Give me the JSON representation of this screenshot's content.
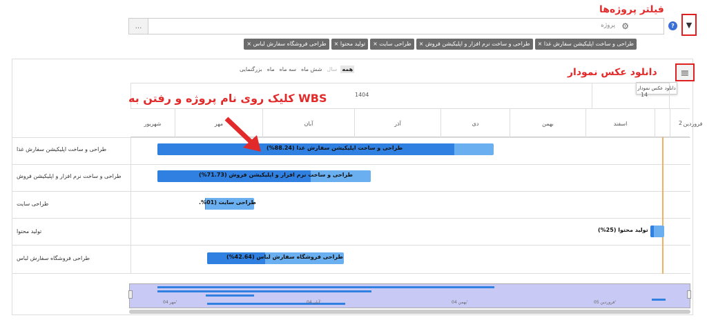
{
  "toolbar": {
    "search_placeholder": "پروژه",
    "more_label": "...",
    "help_label": "?",
    "filter_icon": "filter-icon"
  },
  "annotations": {
    "filter_label": "فیلتر پروژه‌ها",
    "download_label": "دانلود عکس نمودار",
    "click_hint": "کلیک روی نام پروژه و رفتن به WBS"
  },
  "chips": [
    "طراحی و ساخت اپلیکیشن سفارش غذا ×",
    "طراحی و ساخت نرم افزار و اپلیکیشن فروش ×",
    "طراحی سایت ×",
    "تولید محتوا ×",
    "طراحی فروشگاه سفارش لباس ×"
  ],
  "zoom": {
    "options": [
      "همه",
      "سال",
      "شش ماه",
      "سه ماه",
      "ماه",
      "بزرگنمایی"
    ],
    "active": "همه"
  },
  "download_tooltip": "دانلود عکس نمودار",
  "timeline": {
    "year": "1404",
    "next_year_fragment": "14",
    "edge_label": "2",
    "months": [
      "شهریور",
      "مهر",
      "آبان",
      "آذر",
      "دی",
      "بهمن",
      "اسفند",
      "فروردین"
    ]
  },
  "rows": [
    {
      "name": "طراحی و ساخت اپلیکیشن سفارش غذا",
      "bar_label": "طراحی و ساخت اپلیکیشن سفارش غذا (88.24%)",
      "progress": 0.8824
    },
    {
      "name": "طراحی و ساخت نرم افزار و اپلیکیشن فروش",
      "bar_label": "طراحی و ساخت نرم افزار و اپلیکیشن فروش (71.73%)",
      "progress": 0.7173
    },
    {
      "name": "طراحی سایت",
      "bar_label": "طراحی سایت (01%.",
      "progress": 0.01
    },
    {
      "name": "تولید محتوا",
      "bar_label": "تولید محتوا (25%)",
      "progress": 0.25
    },
    {
      "name": "طراحی فروشگاه سفارش لباس",
      "bar_label": "طراحی فروشگاه سفارش لباس (42.64%)",
      "progress": 0.4264
    }
  ],
  "navigator": {
    "ticks": [
      "مهر 04'",
      "آبان 04'",
      "بهمن 04'",
      "فروردین 05'"
    ]
  },
  "colors": {
    "bar_done": "#2f80e0",
    "bar_remaining": "#6ab0f0",
    "annotation_red": "#e32a2a",
    "today_line": "#f0b060"
  }
}
